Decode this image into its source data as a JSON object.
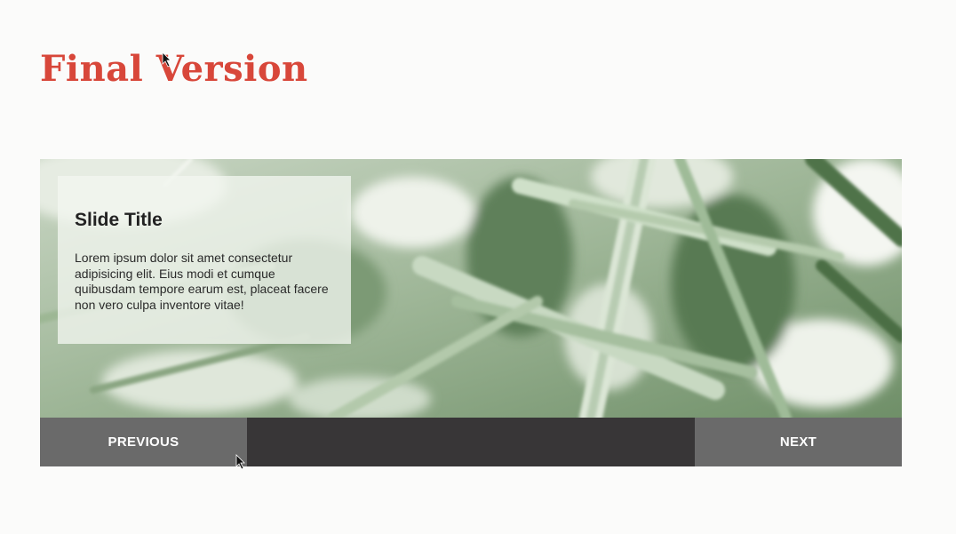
{
  "page": {
    "title": "Final Version"
  },
  "slide": {
    "title": "Slide Title",
    "body": "Lorem ipsum dolor sit amet consectetur adipisicing elit. Eius modi et cumque quibusdam tempore earum est, placeat facere non vero culpa inventore vitae!",
    "image": "palm-leaves-photo"
  },
  "controls": {
    "previous_label": "PREVIOUS",
    "next_label": "NEXT"
  },
  "colors": {
    "title_accent": "#d8473a",
    "button_bg": "#6a6a6a",
    "controls_bg": "#383637",
    "button_text": "#ffffff"
  }
}
